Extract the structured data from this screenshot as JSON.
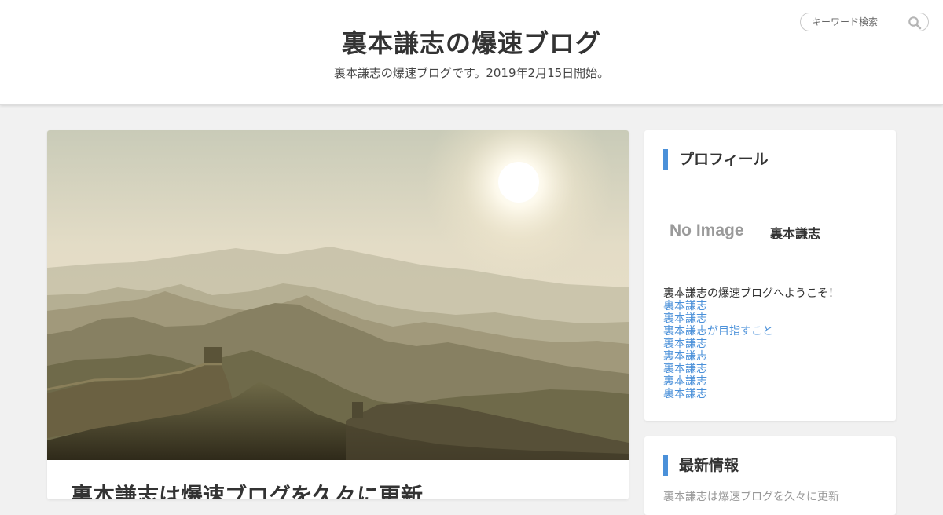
{
  "header": {
    "site_title": "裏本謙志の爆速ブログ",
    "site_description": "裏本謙志の爆速ブログです。2019年2月15日開始。",
    "search_placeholder": "キーワード検索"
  },
  "main": {
    "post_title": "裏本謙志は爆速ブログを久々に更新"
  },
  "sidebar": {
    "profile": {
      "heading": "プロフィール",
      "image_alt": "No Image",
      "name": "裏本謙志",
      "intro": "裏本謙志の爆速ブログへようこそ！",
      "links": [
        "裏本謙志",
        "裏本謙志",
        "裏本謙志が目指すこと",
        "裏本謙志",
        "裏本謙志",
        "裏本謙志",
        "裏本謙志",
        "裏本謙志"
      ]
    },
    "news": {
      "heading": "最新情報",
      "first_item": "裏本謙志は爆速ブログを久々に更新"
    }
  },
  "colors": {
    "accent": "#4a90d9",
    "background": "#f1f1f1",
    "card": "#ffffff",
    "text": "#333333"
  },
  "icons": {
    "search": "search-icon"
  }
}
